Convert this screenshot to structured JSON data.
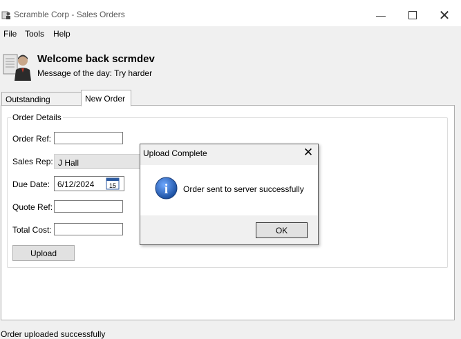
{
  "window": {
    "title": "Scramble Corp - Sales Orders",
    "controls": {
      "minimize": "—",
      "close": "✕"
    }
  },
  "menu": [
    "File",
    "Tools",
    "Help"
  ],
  "header": {
    "welcome": "Welcome back scrmdev",
    "motd": "Message of the day: Try harder"
  },
  "tabs": [
    {
      "label": "Outstanding Orders",
      "active": false
    },
    {
      "label": "New Order",
      "active": true
    }
  ],
  "order_details": {
    "legend": "Order Details",
    "order_ref_label": "Order Ref:",
    "order_ref_value": "",
    "sales_rep_label": "Sales Rep:",
    "sales_rep_value": "J Hall",
    "due_date_label": "Due Date:",
    "due_date_value": "6/12/2024",
    "calendar_day": "15",
    "quote_ref_label": "Quote Ref:",
    "quote_ref_value": "",
    "total_cost_label": "Total Cost:",
    "total_cost_value": "",
    "upload_button": "Upload"
  },
  "status_text": "Order uploaded successfully",
  "dialog": {
    "title": "Upload Complete",
    "close_glyph": "✕",
    "message": "Order sent to server successfully",
    "info_glyph": "i",
    "ok_button": "OK"
  },
  "colors": {
    "info_blue": "#1a5fb4",
    "tab_border": "#adadad"
  }
}
